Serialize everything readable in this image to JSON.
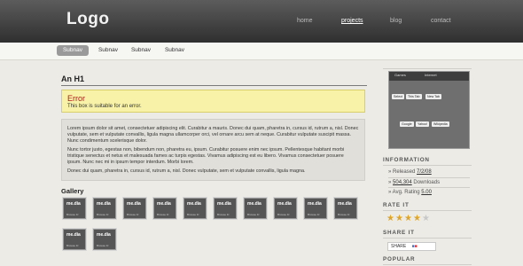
{
  "header": {
    "logo": "Logo",
    "nav": [
      {
        "label": "home",
        "active": false
      },
      {
        "label": "projects",
        "active": true
      },
      {
        "label": "blog",
        "active": false
      },
      {
        "label": "contact",
        "active": false
      }
    ]
  },
  "subnav": [
    "Subnav",
    "Subnav",
    "Subnav",
    "Subnav"
  ],
  "main": {
    "h1": "An H1",
    "error": {
      "title": "Error",
      "text": "This box is suitable for an error."
    },
    "paragraphs": [
      "Lorem ipsum dolor sit amet, consectetuer adipiscing elit. Curabitur a mauris. Donec dui quam, pharetra in, cursus id, rutrum a, nisl. Donec vulputate, sem et vulputate convallis, ligula magna ullamcorper orci, vel ornare arcu sem at neque. Curabitur vulputate suscipit massa. Nunc condimentum scelerisque dolor.",
      "Nunc tortor justo, egestas non, bibendum non, pharetra eu, ipsum. Curabitur posuere enim nec ipsum. Pellentesque habitant morbi tristique senectus et netus et malesuada fames ac turpis egestas. Vivamus adipiscing est eu libero. Vivamus consectetuer posuere ipsum. Nunc nec mi in ipsum tempor interdum. Morbi lorem.",
      "Donec dui quam, pharetra in, cursus id, rutrum a, nisl. Donec vulputate, sem et vulputate convallis, ligula magna."
    ],
    "gallery": {
      "title": "Gallery",
      "thumb_label": "me.dia",
      "thumb_caption": "Browse Fr",
      "count": 12
    }
  },
  "sidebar": {
    "screenshot": {
      "bar_items": [
        "Games",
        "Internet"
      ],
      "buttons_row1": [
        "Select",
        "This Tab",
        "New Tab"
      ],
      "buttons_row2": [
        "Google",
        "Yahoo!",
        "Wikipedia"
      ]
    },
    "information": {
      "heading": "INFORMATION",
      "released_label": "» Released",
      "released_value": "7/2/08",
      "downloads_value": "504,304",
      "downloads_label": "Downloads",
      "rating_label": "» Avg. Rating",
      "rating_value": "5.00"
    },
    "rate_it": {
      "heading": "RATE IT",
      "stars_filled": 4,
      "stars_total": 5,
      "star_color": "#e0a526",
      "star_empty_color": "#c8c8c8"
    },
    "share_it": {
      "heading": "SHARE IT",
      "button_label": "SHARE"
    },
    "popular": {
      "heading": "POPULAR"
    }
  }
}
